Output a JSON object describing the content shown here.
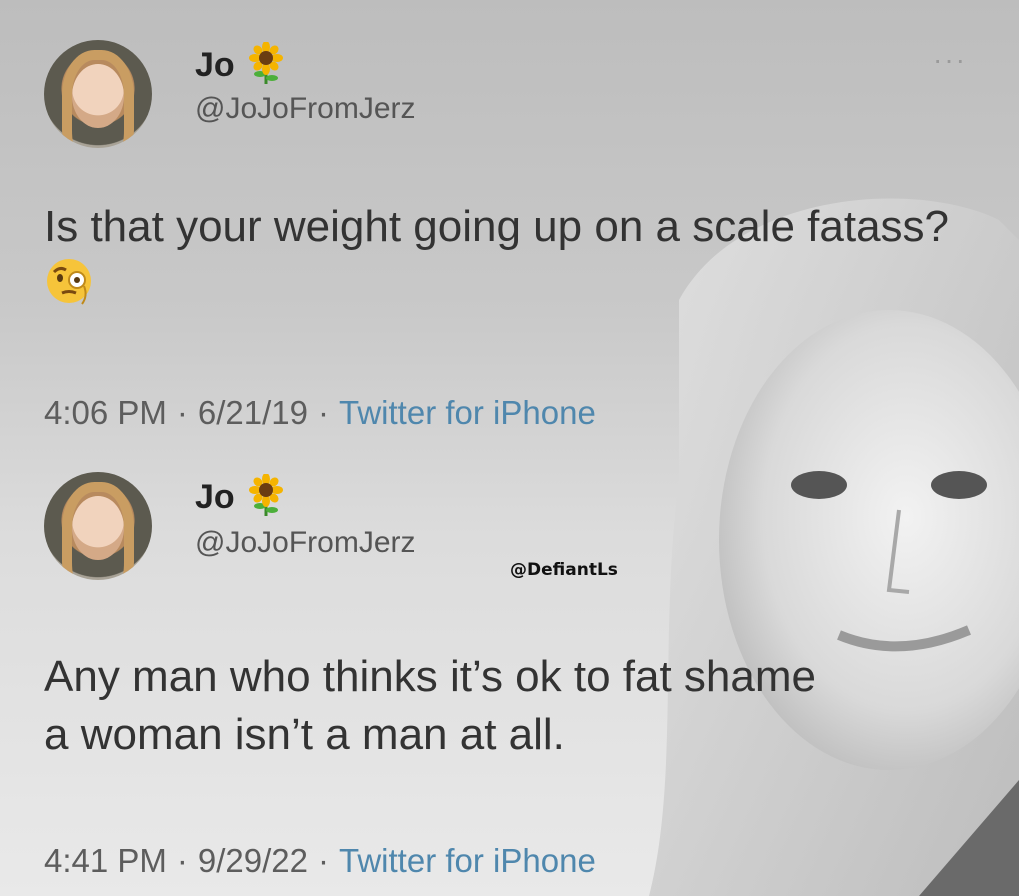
{
  "tweets": [
    {
      "name": "Jo",
      "name_emoji": "sunflower-icon",
      "handle": "@JoJoFromJerz",
      "text": "Is that your weight going up on a scale fatass?",
      "text_emoji": "face-with-monocle-icon",
      "time": "4:06 PM",
      "date": "6/21/19",
      "source": "Twitter for iPhone",
      "separator": "·"
    },
    {
      "name": "Jo",
      "name_emoji": "sunflower-icon",
      "handle": "@JoJoFromJerz",
      "text": "Any man who thinks it’s ok to fat shame a woman isn’t a man at all.",
      "time": "4:41 PM",
      "date": "9/29/22",
      "source": "Twitter for iPhone",
      "separator": "·"
    }
  ],
  "more_menu": "···",
  "watermark": "@DefiantLs",
  "colors": {
    "source_link": "#4f87ad",
    "background": "#cfcfcf"
  }
}
